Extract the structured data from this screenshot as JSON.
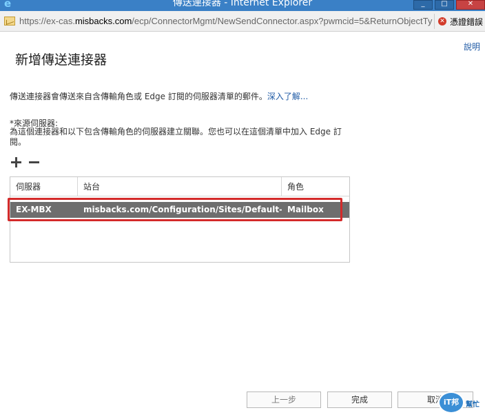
{
  "window": {
    "title": "傳送連接器 - Internet Explorer",
    "address": {
      "scheme": "https://",
      "host_prefix": "ex-cas.",
      "host": "misbacks.com",
      "path": "/ecp/ConnectorMgmt/NewSendConnector.aspx?pwmcid=5&ReturnObjectTy"
    },
    "cert_error_label": "憑證錯誤"
  },
  "help_link": "說明",
  "page_title": "新增傳送連接器",
  "description": {
    "text": "傳送連接器會傳送來自含傳輸角色或 Edge 訂閱的伺服器清單的郵件。",
    "link": "深入了解..."
  },
  "source_servers": {
    "label": "*來源伺服器:",
    "description": "為這個連接器和以下包含傳輸角色的伺服器建立關聯。您也可以在這個清單中加入 Edge 訂閱。"
  },
  "table": {
    "columns": [
      "伺服器",
      "站台",
      "角色"
    ],
    "rows": [
      {
        "server": "EX-MBX",
        "site": "misbacks.com/Configuration/Sites/Default-First-...",
        "role": "Mailbox"
      }
    ]
  },
  "footer": {
    "back": "上一步",
    "finish": "完成",
    "cancel": "取消"
  },
  "watermark": {
    "badge": "iT邦",
    "text": "幫忙"
  },
  "colors": {
    "selected_row": "#6e6e6e",
    "highlight": "#d42a2a",
    "link": "#1f5aa5"
  }
}
